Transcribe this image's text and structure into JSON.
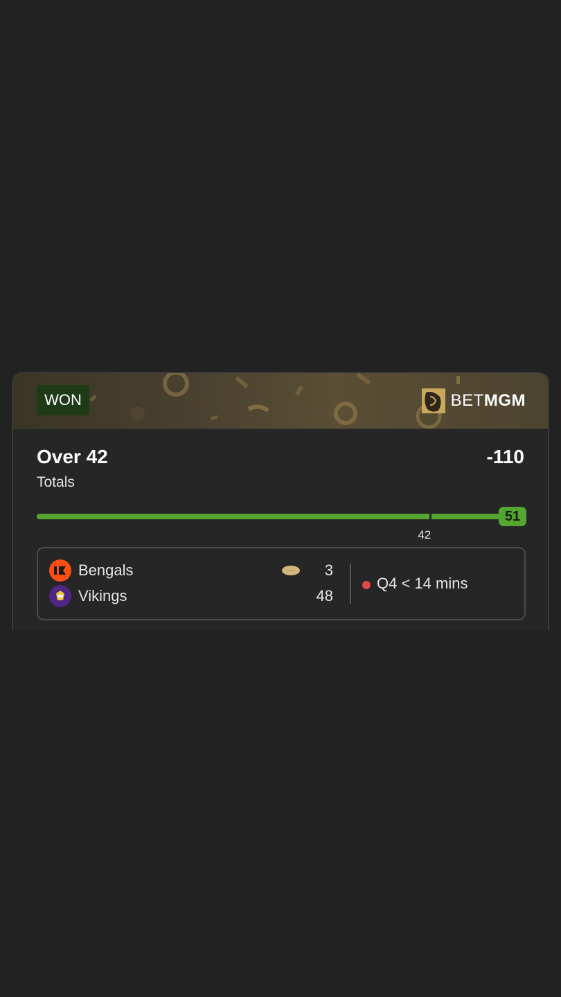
{
  "colors": {
    "background": "#222222",
    "card": "#262626",
    "progress": "#55a630",
    "won_badge": "#1f3a17",
    "gold": "#c9a85c",
    "live": "#e04848"
  },
  "bet": {
    "status": "WON",
    "brand_prefix": "BET",
    "brand_suffix": "MGM",
    "selection": "Over 42",
    "odds": "-110",
    "market": "Totals"
  },
  "progress": {
    "current_value": "51",
    "line_label": "42",
    "line_fraction": 0.835,
    "fill_fraction": 1.0
  },
  "game": {
    "teams": [
      {
        "name": "Bengals",
        "score": "3",
        "logo_icon": "bengals-logo-icon",
        "color": "#fb4f14",
        "has_possession": true
      },
      {
        "name": "Vikings",
        "score": "48",
        "logo_icon": "vikings-logo-icon",
        "color": "#4f2683",
        "has_possession": false
      }
    ],
    "status": "Q4 < 14 mins",
    "status_icon": "live-dot-icon"
  }
}
